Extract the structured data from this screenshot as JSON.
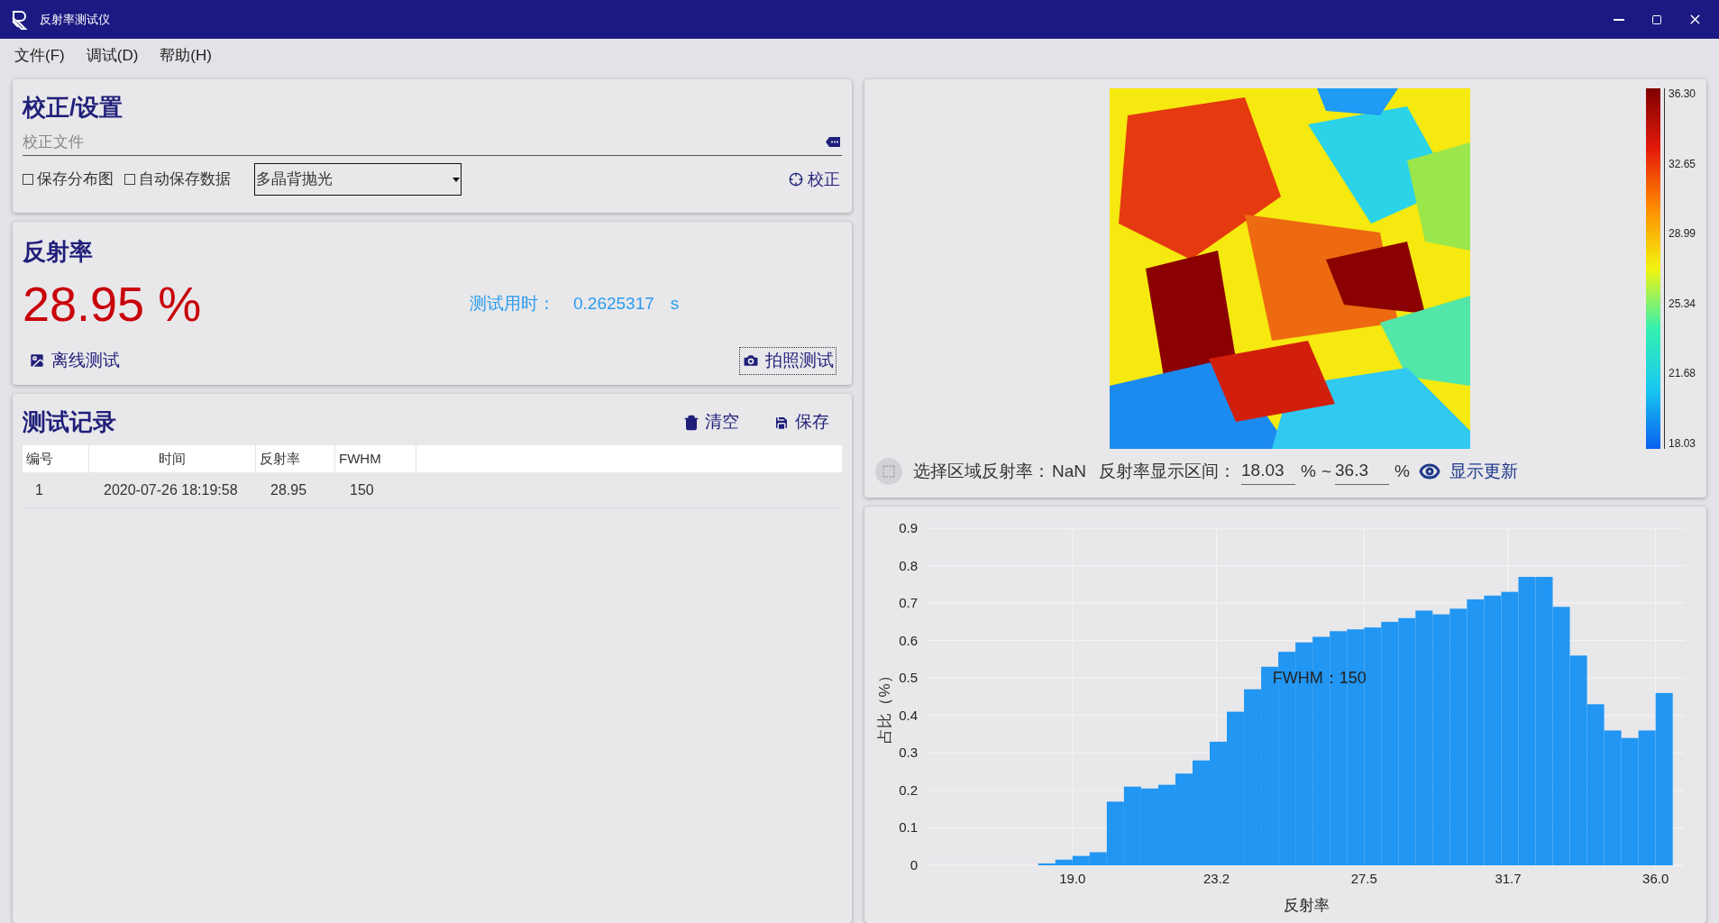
{
  "window": {
    "title": "反射率测试仪"
  },
  "menu": [
    {
      "label": "文件(F)"
    },
    {
      "label": "调试(D)"
    },
    {
      "label": "帮助(H)"
    }
  ],
  "calibration": {
    "title": "校正/设置",
    "file_field": {
      "placeholder": "校正文件"
    },
    "checkboxes": [
      {
        "label": "保存分布图",
        "checked": false
      },
      {
        "label": "自动保存数据",
        "checked": false
      }
    ],
    "dropdown": {
      "value": "多晶背抛光"
    },
    "calibrate_button": "校正"
  },
  "reflectance": {
    "title": "反射率",
    "value": "28.95 %",
    "time_label": "测试用时：",
    "time_value": "0.2625317",
    "time_unit": "s",
    "offline_button": "离线测试",
    "photo_button": "拍照测试"
  },
  "records": {
    "title": "测试记录",
    "clear_button": "清空",
    "save_button": "保存",
    "table": {
      "columns": [
        "编号",
        "时间",
        "反射率",
        "FWHM"
      ],
      "rows": [
        [
          "1",
          "2020-07-26 18:19:58",
          "28.95",
          "150"
        ]
      ]
    }
  },
  "map": {
    "colorbar_ticks": [
      "36.30",
      "32.65",
      "28.99",
      "25.34",
      "21.68",
      "18.03"
    ],
    "region_label": "选择区域反射率：",
    "region_value": "NaN",
    "range_label": "反射率显示区间：",
    "range_min": "18.03",
    "min_unit": "%",
    "range_sep": "~",
    "range_max": "36.3",
    "max_unit": "%",
    "refresh_button": "显示更新"
  },
  "histogram": {
    "chart_data": {
      "type": "bar",
      "xlabel": "反射率",
      "ylabel": "占比（%）",
      "x": [
        18.25,
        18.75,
        19.25,
        19.75,
        20.25,
        20.75,
        21.25,
        21.75,
        22.25,
        22.75,
        23.25,
        23.75,
        24.25,
        24.75,
        25.25,
        25.75,
        26.25,
        26.75,
        27.25,
        27.75,
        28.25,
        28.75,
        29.25,
        29.75,
        30.25,
        30.75,
        31.25,
        31.75,
        32.25,
        32.75,
        33.25,
        33.75,
        34.25,
        34.75,
        35.25,
        35.75,
        36.25
      ],
      "series": [
        {
          "color": "#2196f3",
          "values": [
            0.005,
            0.015,
            0.025,
            0.035,
            0.17,
            0.21,
            0.205,
            0.215,
            0.245,
            0.28,
            0.33,
            0.41,
            0.47,
            0.53,
            0.57,
            0.595,
            0.61,
            0.625,
            0.63,
            0.635,
            0.65,
            0.66,
            0.68,
            0.67,
            0.685,
            0.71,
            0.72,
            0.73,
            0.77,
            0.77,
            0.69,
            0.56,
            0.43,
            0.36,
            0.34,
            0.36,
            0.46
          ]
        }
      ],
      "xlim": [
        14.8,
        36.85
      ],
      "ylim": [
        0,
        0.9
      ],
      "xticks": [
        {
          "value": 19,
          "label": "19.0"
        },
        {
          "value": 23.2,
          "label": "23.2"
        },
        {
          "value": 27.5,
          "label": "27.5"
        },
        {
          "value": 31.7,
          "label": "31.7"
        },
        {
          "value": 36,
          "label": "36.0"
        }
      ],
      "yticks": [
        0,
        0.1,
        0.2,
        0.3,
        0.4,
        0.5,
        0.6,
        0.7,
        0.8,
        0.9
      ],
      "grid": true,
      "annotations": [
        "FWHM：150"
      ]
    }
  }
}
